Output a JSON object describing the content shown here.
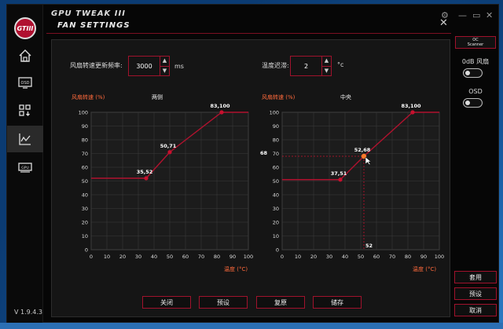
{
  "app": {
    "name": "GPU TWEAK III",
    "subtitle": "FAN SETTINGS",
    "logo": "GTIII",
    "version": "V 1.9.4.3"
  },
  "settings": {
    "refresh_label": "风扇转速更新频率:",
    "refresh_value": "3000",
    "refresh_unit": "ms",
    "hysteresis_label": "温度迟滞:",
    "hysteresis_value": "2",
    "hysteresis_unit": "°c"
  },
  "buttons": {
    "close": "关闭",
    "preset": "预设",
    "restore": "复原",
    "save": "储存"
  },
  "right": {
    "oc_line1": "OC",
    "oc_line2": "Scanner",
    "zero_db": "0dB 风扇",
    "osd": "OSD",
    "apply": "套用",
    "preset": "预设",
    "cancel": "取消"
  },
  "icons": {
    "home": "home-icon",
    "osd": "osd-icon",
    "apps": "apps-icon",
    "monitor": "monitor-icon",
    "gpu": "gpu-icon",
    "settings": "gear-icon",
    "minimize": "minimize-icon",
    "restore": "restore-icon",
    "close": "close-icon",
    "cursor": "cursor-icon"
  },
  "colors": {
    "accent": "#c8102e",
    "curve": "#b0122e",
    "axis_label": "#ff6a3c",
    "grid": "#3a3a3a"
  },
  "chart_data": [
    {
      "type": "line",
      "title": "两侧",
      "ylabel": "风扇转速 (%)",
      "xlabel": "温度 (°C)",
      "xlim": [
        0,
        100
      ],
      "ylim": [
        0,
        100
      ],
      "xticks": [
        0,
        10,
        20,
        30,
        40,
        50,
        60,
        70,
        80,
        90,
        100
      ],
      "yticks": [
        0,
        10,
        20,
        30,
        40,
        50,
        60,
        70,
        80,
        90,
        100
      ],
      "grid": true,
      "series": [
        {
          "x": [
            0,
            35,
            50,
            83,
            100
          ],
          "y": [
            52,
            52,
            71,
            100,
            100
          ]
        }
      ],
      "annotations": [
        {
          "x": 35,
          "y": 52,
          "text": "35,52"
        },
        {
          "x": 50,
          "y": 71,
          "text": "50,71"
        },
        {
          "x": 83,
          "y": 100,
          "text": "83,100"
        }
      ]
    },
    {
      "type": "line",
      "title": "中央",
      "ylabel": "风扇转速 (%)",
      "xlabel": "温度 (°C)",
      "xlim": [
        0,
        100
      ],
      "ylim": [
        0,
        100
      ],
      "xticks": [
        0,
        10,
        20,
        30,
        40,
        50,
        60,
        70,
        80,
        90,
        100
      ],
      "yticks": [
        0,
        10,
        20,
        30,
        40,
        50,
        60,
        70,
        80,
        90,
        100
      ],
      "grid": true,
      "series": [
        {
          "x": [
            0,
            37,
            52,
            83,
            100
          ],
          "y": [
            51,
            51,
            68,
            100,
            100
          ]
        }
      ],
      "annotations": [
        {
          "x": 37,
          "y": 51,
          "text": "37,51"
        },
        {
          "x": 52,
          "y": 68,
          "text": "52,68"
        },
        {
          "x": 83,
          "y": 100,
          "text": "83,100"
        }
      ],
      "crosshair": {
        "x": 52,
        "y": 68,
        "x_text": "52",
        "y_text": "68"
      }
    }
  ]
}
